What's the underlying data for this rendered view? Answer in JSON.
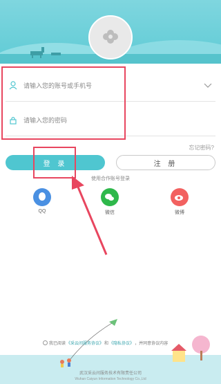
{
  "header": {
    "avatar_icon": "flower-placeholder-icon"
  },
  "form": {
    "account": {
      "placeholder": "请输入您的账号或手机号",
      "icon": "user-icon",
      "dropdown_icon": "chevron-down-icon"
    },
    "password": {
      "placeholder": "请输入您的密码",
      "icon": "lock-icon"
    },
    "forgot_label": "忘记密码?"
  },
  "buttons": {
    "login_label": "登 录",
    "register_label": "注 册"
  },
  "partner_label": "使用合作账号登录",
  "social": [
    {
      "label": "QQ",
      "icon": "qq-icon",
      "color": "#4a90e2"
    },
    {
      "label": "微信",
      "icon": "wechat-icon",
      "color": "#2eb84b"
    },
    {
      "label": "微博",
      "icon": "weibo-icon",
      "color": "#f26160"
    }
  ],
  "agreement": {
    "prefix": "我已阅读",
    "link1": "《采云间服务协议》",
    "middle": "和",
    "link2": "《隐私协议》",
    "suffix": "，并同意协议内容"
  },
  "company": {
    "cn": "武汉采云间服务技术有限责任公司",
    "en": "Wuhan Caiyun Information Technology Co.,Ltd"
  },
  "colors": {
    "accent": "#4fc6d0",
    "highlight": "#e8465f"
  }
}
